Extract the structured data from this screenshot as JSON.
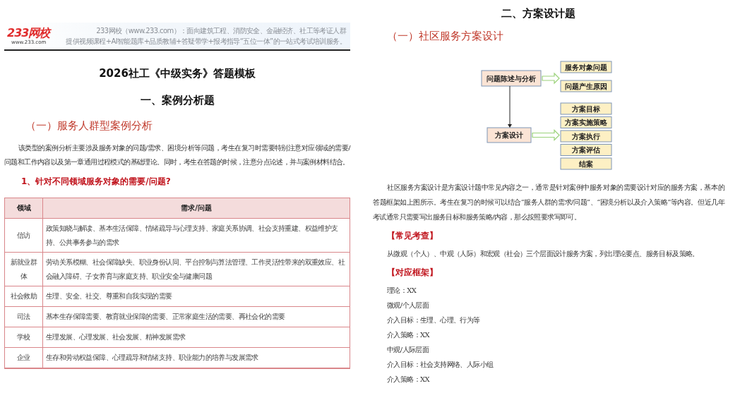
{
  "left_page": {
    "header": {
      "logo": "233网校",
      "logo_url": "www.233.com",
      "lines": [
        "233网校（www.233.com）：面向建筑工程、消防安全、金融经济、社工等考证人群",
        "提供视频课程+AI智能题库+品质教辅+答疑带学+报考指导“五位一体”的一站式考试培训服务。"
      ]
    },
    "title": "2026社工《中级实务》答题模板",
    "section_heading": "一、案例分析题",
    "subsection_heading": "（一）服务人群型案例分析",
    "paragraph": "该类型的案例分析主要涉及服务对象的问题/需求、困境分析等问题，考生在复习时需要特别注意对应领域的需要/问题和工作内容以及第一章通用过程模式的基础理论。同时，考生在答题的时候，注意分点论述，并与案例材料结合。",
    "question": "1、针对不同领域服务对象的需要/问题?",
    "table": {
      "columns": [
        "领域",
        "需求/问题"
      ],
      "rows": [
        {
          "cells": [
            "信访",
            "政策知晓与解读、基本生活保障、情绪疏导与心理支持、家庭关系协调、社会支持重建、权益维护支持、公共事务参与的需求"
          ]
        },
        {
          "cells": [
            "新就业群体",
            "劳动关系模糊、社会保障缺失、职业身份认同、平台控制与算法管理、工作灵活性带来的双重效应、社会融入障碍、子女养育与家庭支持、职业安全与健康问题"
          ]
        },
        {
          "cells": [
            "社会救助",
            "生理、安全、社交、尊重和自我实现的需要"
          ]
        },
        {
          "cells": [
            "司法",
            "基本生存保障需要、教育就业保障的需要、正常家庭生活的需要、再社会化的需要"
          ]
        },
        {
          "cells": [
            "学校",
            "生理发展、心理发展、社会发展、精神发展需求"
          ]
        },
        {
          "cells": [
            "企业",
            "生存和劳动权益保障、心理疏导和情绪支持、职业能力的培养与发展需求"
          ]
        }
      ]
    }
  },
  "right_page": {
    "section_heading": "二、方案设计题",
    "subsection_heading": "（一）社区服务方案设计",
    "diagram": {
      "main_nodes": [
        {
          "label": "问题陈述与分析",
          "outputs": [
            "服务对象问题",
            "问题产生原因"
          ]
        },
        {
          "label": "方案设计",
          "outputs": [
            "方案目标",
            "方案实施策略",
            "方案执行",
            "方案评估",
            "结案"
          ]
        }
      ]
    },
    "paragraph": "社区服务方案设计是方案设计题中常见内容之一，通常是针对案例中服务对象的需要设计对应的服务方案，基本的答题框架如上图所示。考生在复习的时候可以结合“服务人群的需求/问题”、“困境分析以及介入策略”等内容。但近几年考试通常只需要写出服务目标和服务策略/内容，那么按照要求写即可。",
    "common_heading": "【常见考查】",
    "common_text": "从微观（个人）、中观（人际）和宏观（社会）三个层面设计服务方案，列出理论要点、服务目标及策略。",
    "framework_heading": "【对应框架】",
    "framework_lines": [
      "理论：XX",
      "微观/个人层面",
      "介入目标：生理、心理、行为等",
      "介入策略：XX",
      "中观/人际层面",
      "介入目标：社会支持网络、人际小组",
      "介入策略：XX"
    ]
  }
}
